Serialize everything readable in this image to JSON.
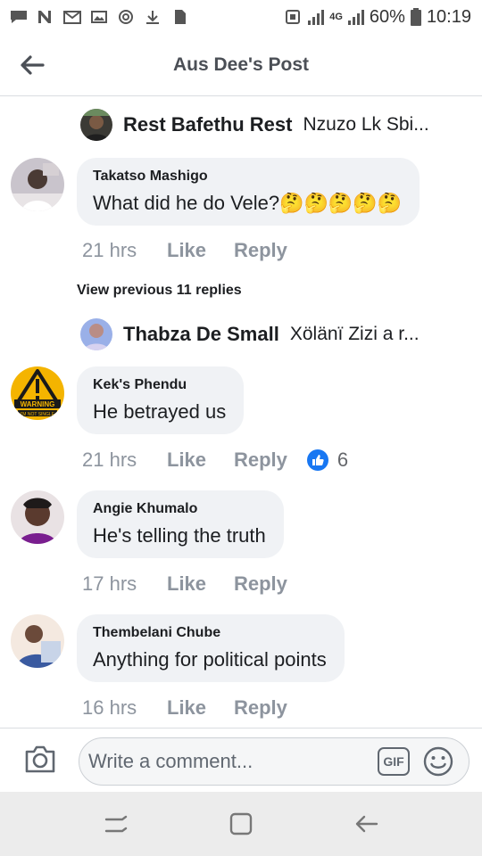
{
  "status_bar": {
    "battery_percent": "60%",
    "time": "10:19",
    "network_label": "4G",
    "left_icons": [
      "chat-icon",
      "n-icon",
      "mail-icon",
      "image-icon",
      "sync-icon",
      "download-icon",
      "sim-icon"
    ],
    "right_icons": [
      "nfc-icon",
      "signal-icon",
      "signal-4g-icon",
      "battery-icon"
    ]
  },
  "header": {
    "title": "Aus Dee's Post",
    "back_icon": "arrow-left-icon"
  },
  "thread": {
    "reply_preview_1": {
      "name": "Rest Bafethu Rest",
      "text": "Nzuzo Lk Sbi..."
    },
    "view_previous": "View previous 11 replies",
    "reply_preview_2": {
      "name": "Thabza De Small",
      "text": "Xölänï Zizi a r..."
    },
    "comments": [
      {
        "author": "Takatso Mashigo",
        "text": "What did he do Vele?🤔🤔🤔🤔🤔",
        "time": "21 hrs",
        "like": "Like",
        "reply": "Reply"
      },
      {
        "author": "Kek's Phendu",
        "text": "He betrayed us",
        "time": "21 hrs",
        "like": "Like",
        "reply": "Reply",
        "reaction_count": "6"
      },
      {
        "author": "Angie Khumalo",
        "text": "He's telling the truth",
        "time": "17 hrs",
        "like": "Like",
        "reply": "Reply"
      },
      {
        "author": "Thembelani Chube",
        "text": "Anything for political points",
        "time": "16 hrs",
        "like": "Like",
        "reply": "Reply"
      }
    ],
    "avatar_badge_text": [
      "WARNING",
      "I'M NOT SINGLE"
    ]
  },
  "composer": {
    "placeholder": "Write a comment...",
    "gif_label": "GIF",
    "camera_icon": "camera-icon",
    "emoji_icon": "smiley-icon"
  },
  "nav": {
    "icons": [
      "recents-icon",
      "home-icon",
      "back-icon"
    ]
  },
  "colors": {
    "bubble": "#f0f2f5",
    "meta_text": "#8d949e",
    "like_blue": "#1877f2",
    "nav_bg": "#ececec"
  }
}
